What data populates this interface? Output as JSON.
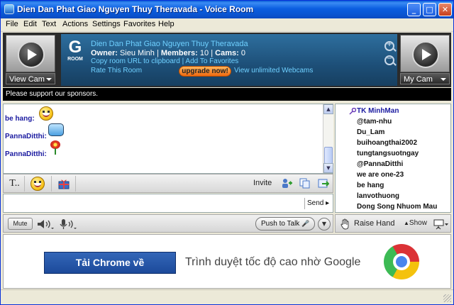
{
  "window": {
    "title": "Dien Dan Phat Giao Nguyen Thuy Theravada - Voice Room",
    "minimize_glyph": "_",
    "maximize_glyph": "□",
    "close_glyph": "✕"
  },
  "menu": [
    "File",
    "Edit",
    "Text",
    "Actions",
    "Settings",
    "Favorites",
    "Help"
  ],
  "header": {
    "view_cam_label": "View Cam",
    "my_cam_label": "My Cam",
    "badge_letter": "G",
    "badge_sub": "ROOM",
    "room_name": "Dien Dan Phat Giao Nguyen Thuy Theravada",
    "owner_label": "Owner",
    "owner_value": "Sieu Minh",
    "members_label": "Members",
    "members_value": "10",
    "cams_label": "Cams",
    "cams_value": "0",
    "copy_url": "Copy room URL to clipboard",
    "separator": "|",
    "add_favorites": "Add To Favorites",
    "rate_room": "Rate This Room",
    "upgrade": "upgrade now!",
    "webcams": "View unlimited Webcams"
  },
  "sponsor_text": "Please support our sponsors.",
  "chat": {
    "lines": [
      {
        "user": "be hang:",
        "icon": "smiley-icon"
      },
      {
        "user": "PannaDitthi:",
        "icon": "speech-bubble-icon"
      },
      {
        "user": "PannaDitthi:",
        "icon": "flower-icon"
      }
    ]
  },
  "toolbar": {
    "invite_label": "Invite",
    "font_glyph": "T.."
  },
  "input": {
    "value": "",
    "send_label": "Send ▸"
  },
  "audio": {
    "mute_label": "Mute",
    "push_to_talk": "Push to Talk"
  },
  "users": [
    "TK MinhMan",
    "@tam-nhu",
    "Du_Lam",
    "buihoangthai2002",
    "tungtangsuotngay",
    "@PannaDitthi",
    "we are one-23",
    "be hang",
    "lanvothuong",
    "Dong Song Nhuom Mau"
  ],
  "userbar": {
    "raise_hand": "Raise Hand",
    "show_label": "Show"
  },
  "ad": {
    "button": "Tải Chrome về",
    "tagline": "Trình duyệt tốc độ cao nhờ Google"
  }
}
